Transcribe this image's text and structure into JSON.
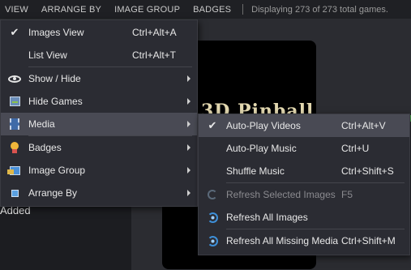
{
  "menubar": {
    "items": [
      "VIEW",
      "ARRANGE BY",
      "IMAGE GROUP",
      "BADGES"
    ],
    "status": "Displaying 273 of 273 total games."
  },
  "background": {
    "added_label": "Added",
    "game_title_fragment": "3D Pinball"
  },
  "view_menu": {
    "items": [
      {
        "label": "Images View",
        "shortcut": "Ctrl+Alt+A",
        "checked": true,
        "icon": "check"
      },
      {
        "label": "List View",
        "shortcut": "Ctrl+Alt+T",
        "checked": false,
        "icon": ""
      },
      {
        "label": "Show / Hide",
        "shortcut": "",
        "submenu": true,
        "icon": "eye-icon"
      },
      {
        "label": "Hide Games",
        "shortcut": "",
        "submenu": true,
        "icon": "hide-games-icon"
      },
      {
        "label": "Media",
        "shortcut": "",
        "submenu": true,
        "active": true,
        "icon": "film-icon"
      },
      {
        "label": "Badges",
        "shortcut": "",
        "submenu": true,
        "icon": "badge-icon"
      },
      {
        "label": "Image Group",
        "shortcut": "",
        "submenu": true,
        "icon": "image-group-icon"
      },
      {
        "label": "Arrange By",
        "shortcut": "",
        "submenu": true,
        "icon": "arrange-icon"
      }
    ]
  },
  "media_menu": {
    "items": [
      {
        "label": "Auto-Play Videos",
        "shortcut": "Ctrl+Alt+V",
        "checked": true,
        "active": true
      },
      {
        "label": "Auto-Play Music",
        "shortcut": "Ctrl+U"
      },
      {
        "label": "Shuffle Music",
        "shortcut": "Ctrl+Shift+S"
      },
      {
        "label": "Refresh Selected Images",
        "shortcut": "F5",
        "disabled": true,
        "icon": "refresh-icon"
      },
      {
        "label": "Refresh All Images",
        "shortcut": "",
        "icon": "refresh-all-icon"
      },
      {
        "label": "Refresh All Missing Media",
        "shortcut": "Ctrl+Shift+M",
        "icon": "refresh-missing-icon"
      }
    ]
  },
  "check_glyph": "✔",
  "colors": {
    "menu_bg": "#2b2c33",
    "active_item_bg": "#494a54",
    "app_bg": "#1f2024",
    "disabled_text": "#8a8a8f"
  }
}
